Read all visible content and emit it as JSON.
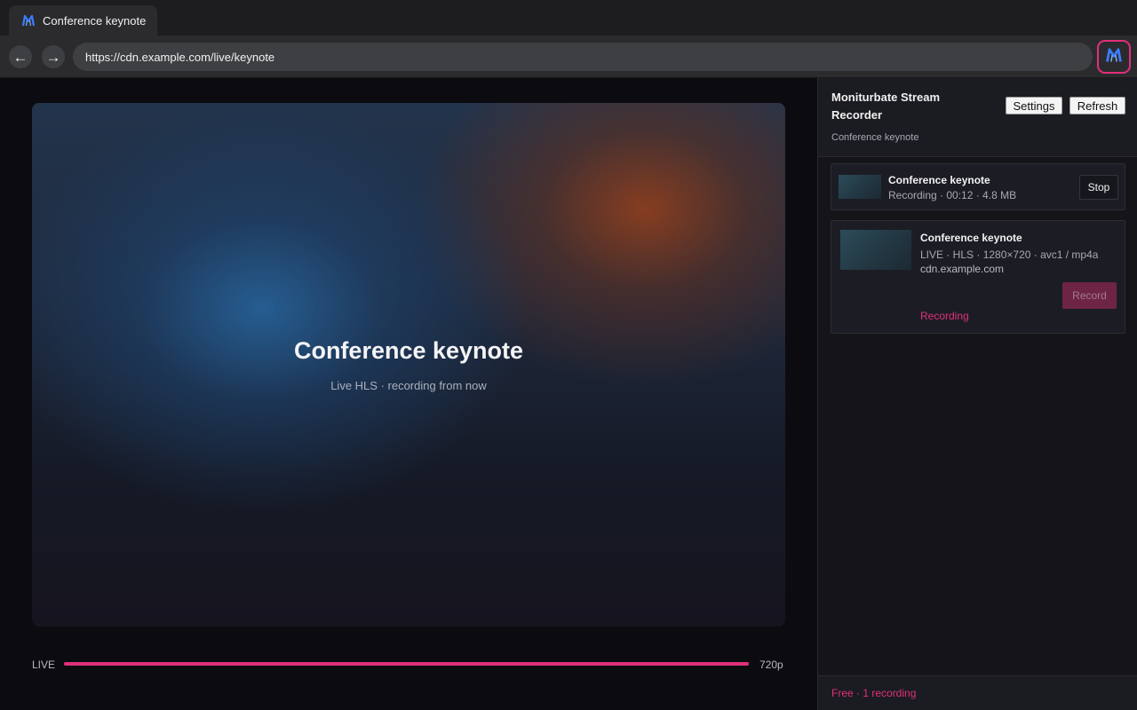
{
  "colors": {
    "accent": "#e0307a",
    "logo_blue": "#3b7dff",
    "panel_bg": "#151519"
  },
  "browser": {
    "tab": {
      "title": "Conference keynote",
      "icon": "monitorbate-logo-icon"
    },
    "nav": {
      "back_glyph": "←",
      "forward_glyph": "→"
    },
    "url": "https://cdn.example.com/live/keynote",
    "extension_icon": "monitorbate-logo-icon"
  },
  "player": {
    "title": "Conference keynote",
    "subtitle": "Live HLS · recording from now",
    "live_label": "LIVE",
    "quality": "720p",
    "progress": 1.0
  },
  "panel": {
    "title": "Moniturbate Stream Recorder",
    "subtitle": "Conference keynote",
    "settings_label": "Settings",
    "refresh_label": "Refresh",
    "active_recording": {
      "title": "Conference keynote",
      "meta": "Recording · 00:12 · 4.8 MB",
      "stop_label": "Stop"
    },
    "stream": {
      "title": "Conference keynote",
      "meta": "LIVE · HLS · 1280×720 · avc1 / mp4a",
      "host": "cdn.example.com",
      "record_label": "Record",
      "status": "Recording"
    },
    "footer": "Free · 1 recording"
  }
}
